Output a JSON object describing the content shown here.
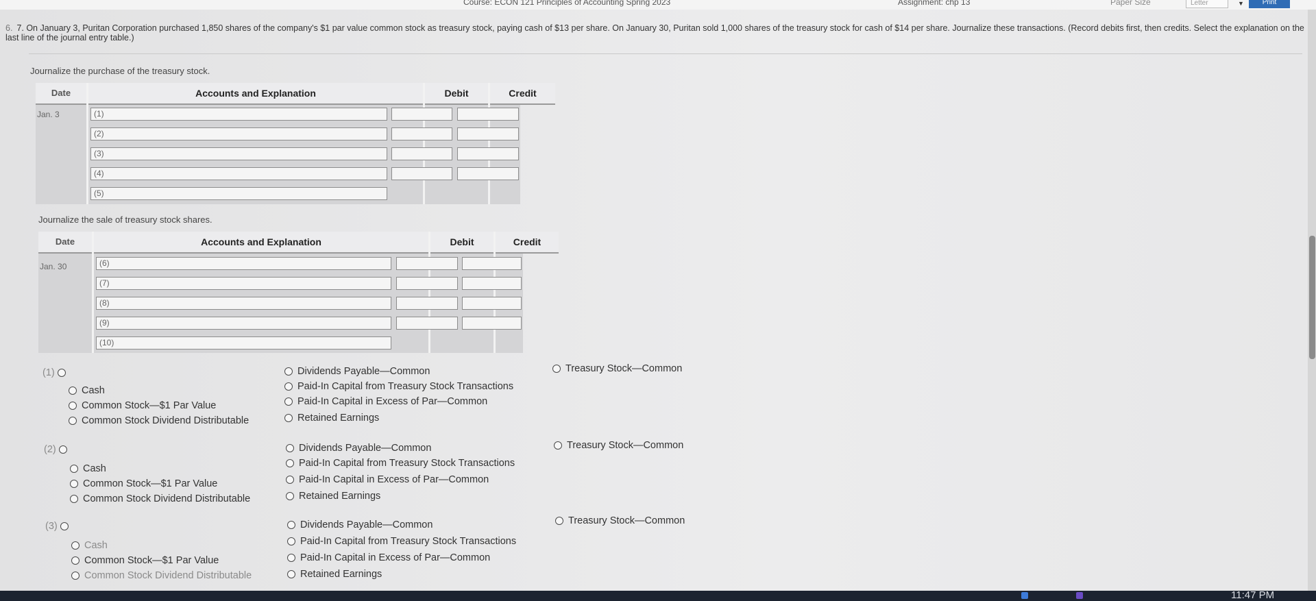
{
  "topbar": {
    "course": "Course: ECON 121 Principles of Accounting Spring 2023",
    "assignment": "Assignment: chp 13",
    "paper_size_label": "Paper Size",
    "paper_size_value": "Letter",
    "print_label": "Print"
  },
  "question": {
    "number": "6.",
    "text": "7. On January 3, Puritan Corporation purchased 1,850 shares of the company's $1 par value common stock as treasury stock, paying cash of $13 per share. On January 30, Puritan sold 1,000 shares of the treasury stock for cash of $14 per share. Journalize these transactions. (Record debits first, then credits. Select the explanation on the last line of the journal entry table.)"
  },
  "table1": {
    "prompt": "Journalize the purchase of the treasury stock.",
    "headers": {
      "date": "Date",
      "accounts": "Accounts and Explanation",
      "debit": "Debit",
      "credit": "Credit"
    },
    "date": "Jan. 3",
    "rows": [
      "(1)",
      "(2)",
      "(3)",
      "(4)",
      "(5)"
    ]
  },
  "table2": {
    "prompt": "Journalize the sale of treasury stock shares.",
    "headers": {
      "date": "Date",
      "accounts": "Accounts and Explanation",
      "debit": "Debit",
      "credit": "Credit"
    },
    "date": "Jan. 30",
    "rows": [
      "(6)",
      "(7)",
      "(8)",
      "(9)",
      "(10)"
    ]
  },
  "option_groups": [
    {
      "label": "(1)"
    },
    {
      "label": "(2)"
    },
    {
      "label": "(3)"
    }
  ],
  "options": {
    "cash": "Cash",
    "common_stock": "Common Stock—$1 Par Value",
    "cs_dividend_dist": "Common Stock Dividend Distributable",
    "dividends_payable": "Dividends Payable—Common",
    "paid_in_treasury": "Paid-In Capital from Treasury Stock Transactions",
    "paid_in_excess": "Paid-In Capital in Excess of Par—Common",
    "retained_earnings": "Retained Earnings",
    "treasury_stock": "Treasury Stock—Common"
  },
  "taskbar": {
    "clock": "11:47 PM"
  }
}
